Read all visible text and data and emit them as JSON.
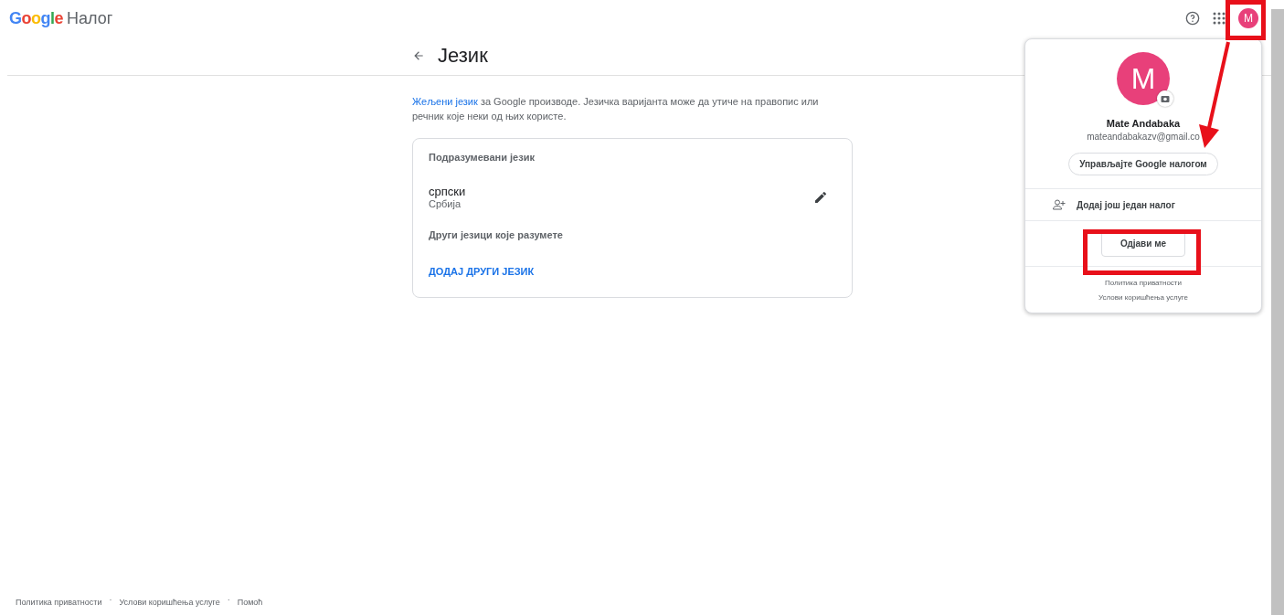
{
  "header": {
    "logo": "Google",
    "product": "Налог",
    "avatar_letter": "M"
  },
  "page": {
    "title": "Језик",
    "intro_link": "Жељени језик",
    "intro": " за Google производе. Језичка варијанта може да утиче на правопис или речник које неки од њих користе.",
    "card": {
      "default_heading": "Подразумевани језик",
      "language": "српски",
      "region": "Србија",
      "other_heading": "Други језици које разумете",
      "add_button": "ДОДАЈ ДРУГИ ЈЕЗИК"
    }
  },
  "account_menu": {
    "avatar_letter": "M",
    "name": "Mate Andabaka",
    "email": "mateandabakazv@gmail.co",
    "manage_button": "Управљајте Google налогом",
    "add_account": "Додај још један налог",
    "sign_out": "Одјави ме",
    "links": [
      "Политика приватности",
      "Услови коришћења услуге"
    ]
  },
  "footer": {
    "separator": "·",
    "links": [
      "Политика приватности",
      "Услови коришћења услуге",
      "Помоћ"
    ]
  }
}
